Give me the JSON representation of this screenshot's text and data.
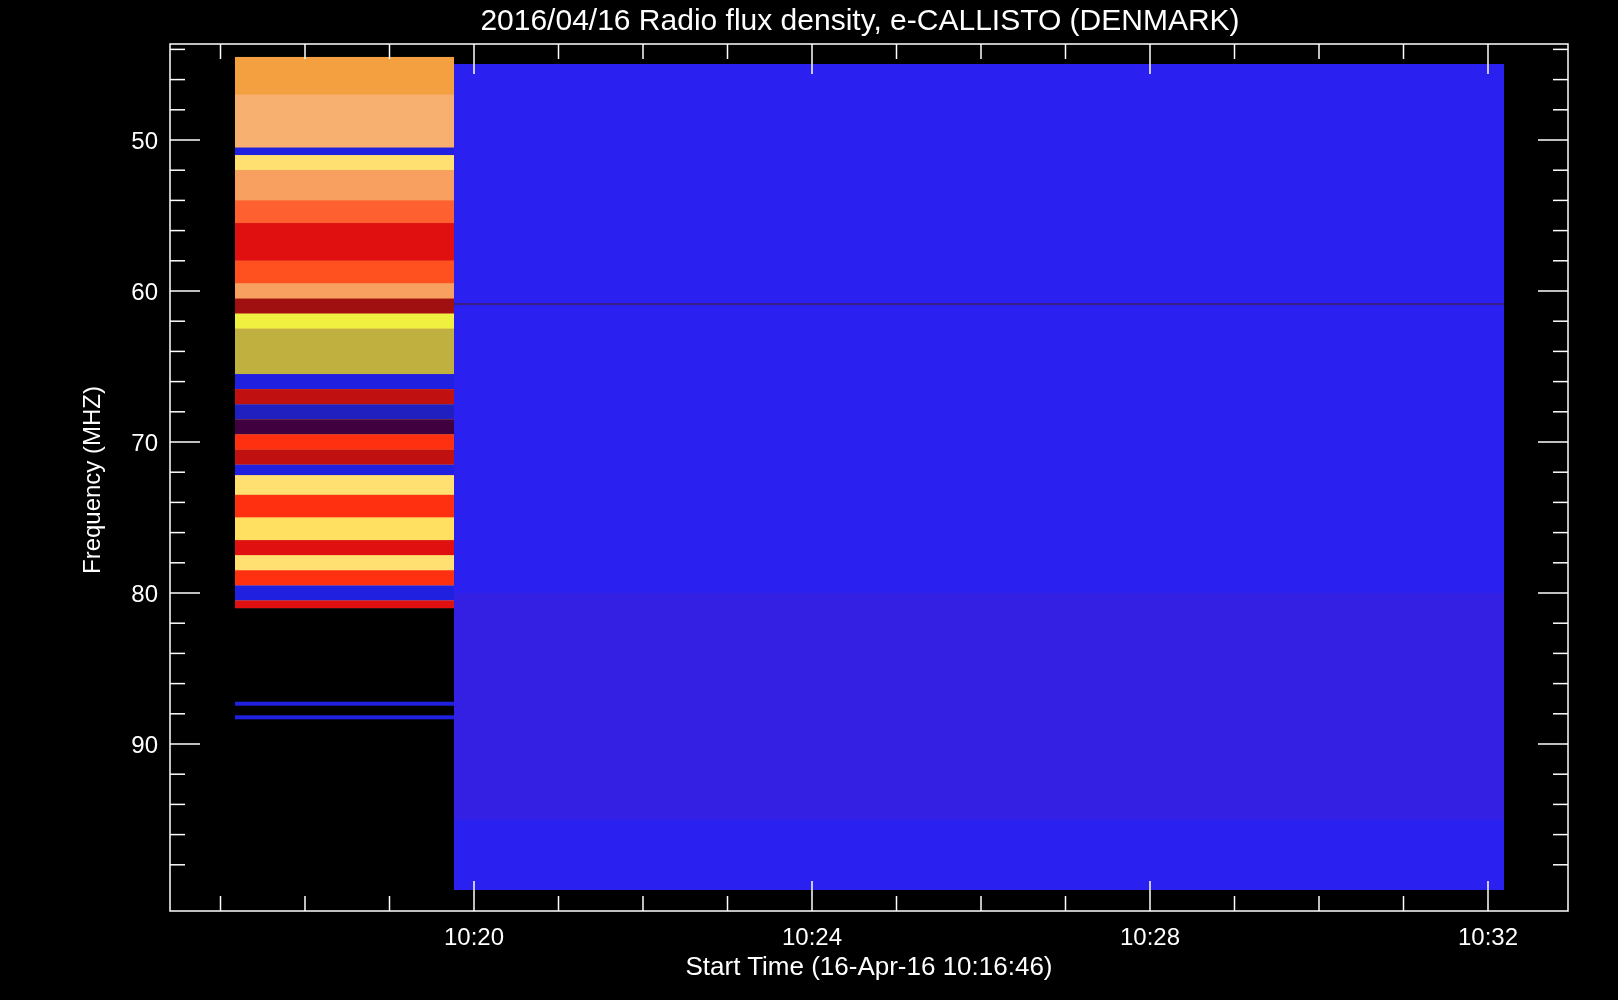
{
  "title": "2016/04/16  Radio flux density, e-CALLISTO (DENMARK)",
  "ylabel": "Frequency (MHZ)",
  "xlabel": "Start Time (16-Apr-16 10:16:46)",
  "yticks": [
    "50",
    "60",
    "70",
    "80",
    "90"
  ],
  "xticks": [
    "10:20",
    "10:24",
    "10:28",
    "10:32"
  ]
}
